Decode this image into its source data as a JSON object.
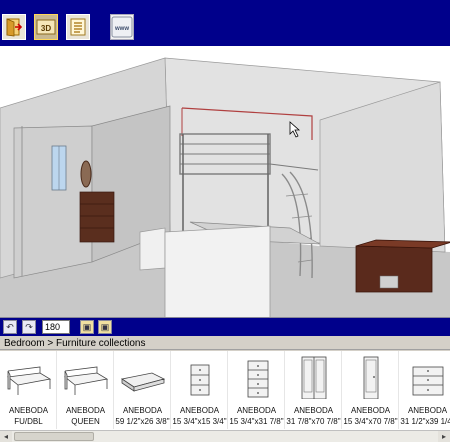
{
  "toolbar": {
    "buttons": [
      {
        "icon": "exit-door-icon"
      },
      {
        "icon": "3d-view-icon",
        "label": "3D",
        "pressed": true
      },
      {
        "icon": "product-list-icon"
      },
      {
        "icon": "www-icon",
        "label": "www"
      }
    ],
    "colors": {
      "bar": "#00008b",
      "accent": "#ffd75a"
    }
  },
  "view_controls": {
    "angle_value": "180"
  },
  "breadcrumb": {
    "root": "Bedroom",
    "separator": ">",
    "current": "Furniture collections"
  },
  "products": [
    {
      "name": "ANEBODA",
      "size": "FU/DBL",
      "icon": "bed-frame-icon"
    },
    {
      "name": "ANEBODA",
      "size": "QUEEN",
      "icon": "bed-frame-icon"
    },
    {
      "name": "ANEBODA",
      "size": "59 1/2\"x26 3/8\"",
      "icon": "under-bed-drawer-icon"
    },
    {
      "name": "ANEBODA",
      "size": "15 3/4\"x15 3/4\"",
      "icon": "nightstand-icon"
    },
    {
      "name": "ANEBODA",
      "size": "15 3/4\"x31 7/8\"",
      "icon": "chest-of-drawers-icon"
    },
    {
      "name": "ANEBODA",
      "size": "31 7/8\"x70 7/8\"",
      "icon": "wardrobe-icon"
    },
    {
      "name": "ANEBODA",
      "size": "15 3/4\"x70 7/8\"",
      "icon": "narrow-wardrobe-icon"
    },
    {
      "name": "ANEBODA",
      "size": "31 1/2\"x39 1/4\"",
      "icon": "dresser-icon"
    }
  ]
}
